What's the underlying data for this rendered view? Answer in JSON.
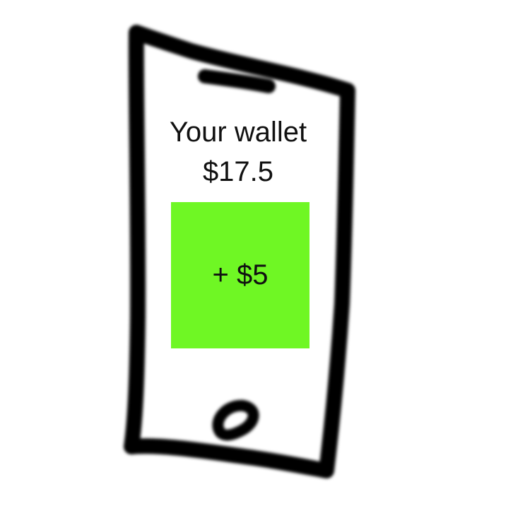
{
  "wallet": {
    "title": "Your wallet",
    "balance": "$17.5"
  },
  "add_funds": {
    "label": "+ $5",
    "color": "#6ff724"
  },
  "sketch": {
    "stroke_color": "#000000"
  }
}
